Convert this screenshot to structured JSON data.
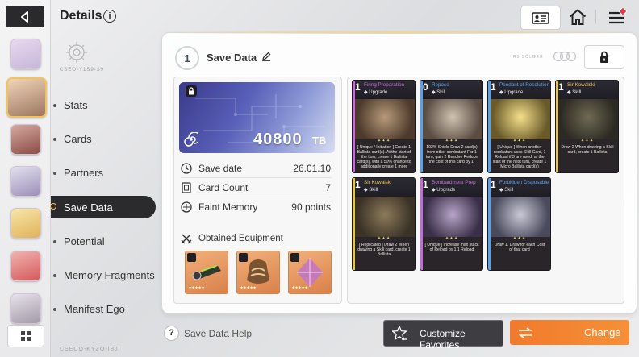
{
  "header": {
    "title": "Details",
    "info_icon": "info-icon"
  },
  "nav": {
    "items": [
      "Stats",
      "Cards",
      "Partners",
      "Save Data",
      "Potential",
      "Memory Fragments",
      "Manifest Ego"
    ],
    "active": "Save Data",
    "sigil_text": "CSEO-Y1S9-S9",
    "bottom_code": "CSECO-KYZO-IBJI"
  },
  "save": {
    "rank": "1",
    "title": "Save Data",
    "tb_value": "40800",
    "tb_unit": "TB",
    "ring_label": "R9 SOLGER",
    "rows": [
      {
        "label": "Save date",
        "value": "26.01.10",
        "icon": "clock-icon"
      },
      {
        "label": "Card Count",
        "value": "7",
        "icon": "card-icon"
      },
      {
        "label": "Faint Memory",
        "value": "90 points",
        "icon": "memory-icon"
      }
    ],
    "equipment_label": "Obtained Equipment",
    "equipment": [
      {
        "name": "weapon",
        "icon": "sword-icon"
      },
      {
        "name": "armor",
        "icon": "shirt-icon"
      },
      {
        "name": "accessory",
        "icon": "ring-icon"
      }
    ]
  },
  "cards": [
    {
      "cost": "1",
      "name": "Firing Preparation",
      "type": "Upgrade",
      "desc": "[ Unique / Initiation ] Create 1 Ballista card(s). At the start of the turn, create 1 Ballista card(s), with a 50% chance to additionally create 1 more",
      "accent": "#c46bd8"
    },
    {
      "cost": "0",
      "name": "Repose",
      "type": "Skill",
      "desc": "102% Shield Draw 2 card(s) from other combatant For 1 turn, gain 2 Resolve Reduce the cost of this card by 1.",
      "accent": "#5aa0e6"
    },
    {
      "cost": "1",
      "name": "Pendant of Resolution",
      "type": "Upgrade",
      "desc": "[ Unique ] When another combatant uses Skill Card, 1 Reload if 3 are used, at the start of the next turn, create 1 Micro Ballista card(s)",
      "accent": "#5aa0e6"
    },
    {
      "cost": "1",
      "name": "Sir Kowalski",
      "type": "Skill",
      "desc": "Draw 2 When drawing a Skill card, create 1 Ballista",
      "accent": "#e8c451"
    },
    {
      "cost": "1",
      "name": "Sir Kowalski",
      "type": "Skill",
      "desc": "[ Replicated ] Draw 2 When drawing a Skill card, create 1 Ballista",
      "accent": "#e8c451"
    },
    {
      "cost": "1",
      "name": "Bombardment Prep",
      "type": "Upgrade",
      "desc": "[ Unique ] Increase max stack of Reload by 1 1 Reload",
      "accent": "#c46bd8"
    },
    {
      "cost": "1",
      "name": "Forbidden Disposable Sys",
      "type": "Skill",
      "desc": "Draw 1. Draw for each Cost of that card",
      "accent": "#5aa0e6"
    }
  ],
  "footer": {
    "help": "Save Data Help",
    "favorites": "Customize Favorites",
    "change": "Change"
  },
  "colors": {
    "accent_orange": "#f17a2b",
    "dark": "#2b2b2e",
    "gold": "#f3c25a"
  }
}
